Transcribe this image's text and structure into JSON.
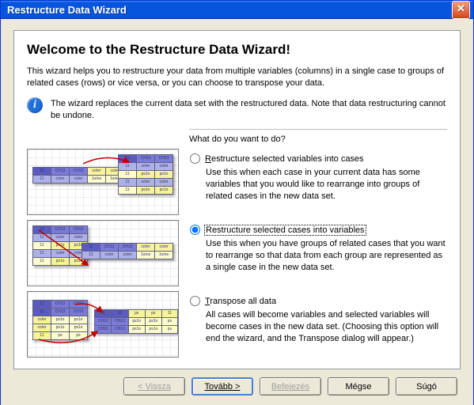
{
  "window": {
    "title": "Restructure Data Wizard",
    "close": "✕"
  },
  "heading": "Welcome to the Restructure Data Wizard!",
  "intro": "This wizard helps you to restructure your data from multiple variables (columns) in a single case to groups of related cases (rows) or vice versa, or you can choose to transpose your data.",
  "notice": "The wizard replaces the current data set with the restructured data.  Note that data restructuring cannot be undone.",
  "question": "What do you want to do?",
  "options": [
    {
      "label": "Restructure selected variables into cases",
      "desc": "Use this when each case in your current data has some variables that you would like to rearrange into groups of related cases in the new data set.",
      "selected": false
    },
    {
      "label": "Restructure selected cases into variables",
      "desc": "Use this when you have groups of related cases that you want to rearrange so that data from each group are represented as a single case in the new data set.",
      "selected": true
    },
    {
      "label": "Transpose all data",
      "desc": "All cases will become variables and selected variables will become cases in the new data set. (Choosing this option will end the wizard, and the Transpose dialog will appear.)",
      "selected": false
    }
  ],
  "buttons": {
    "back": "< Vissza",
    "next": "Tovább >",
    "finish": "Befejezés",
    "cancel": "Mégse",
    "help": "Súgó"
  },
  "accent_colors": {
    "titlebar": "#0855dd",
    "close_btn": "#d6441a",
    "info_icon": "#1e6edc"
  }
}
